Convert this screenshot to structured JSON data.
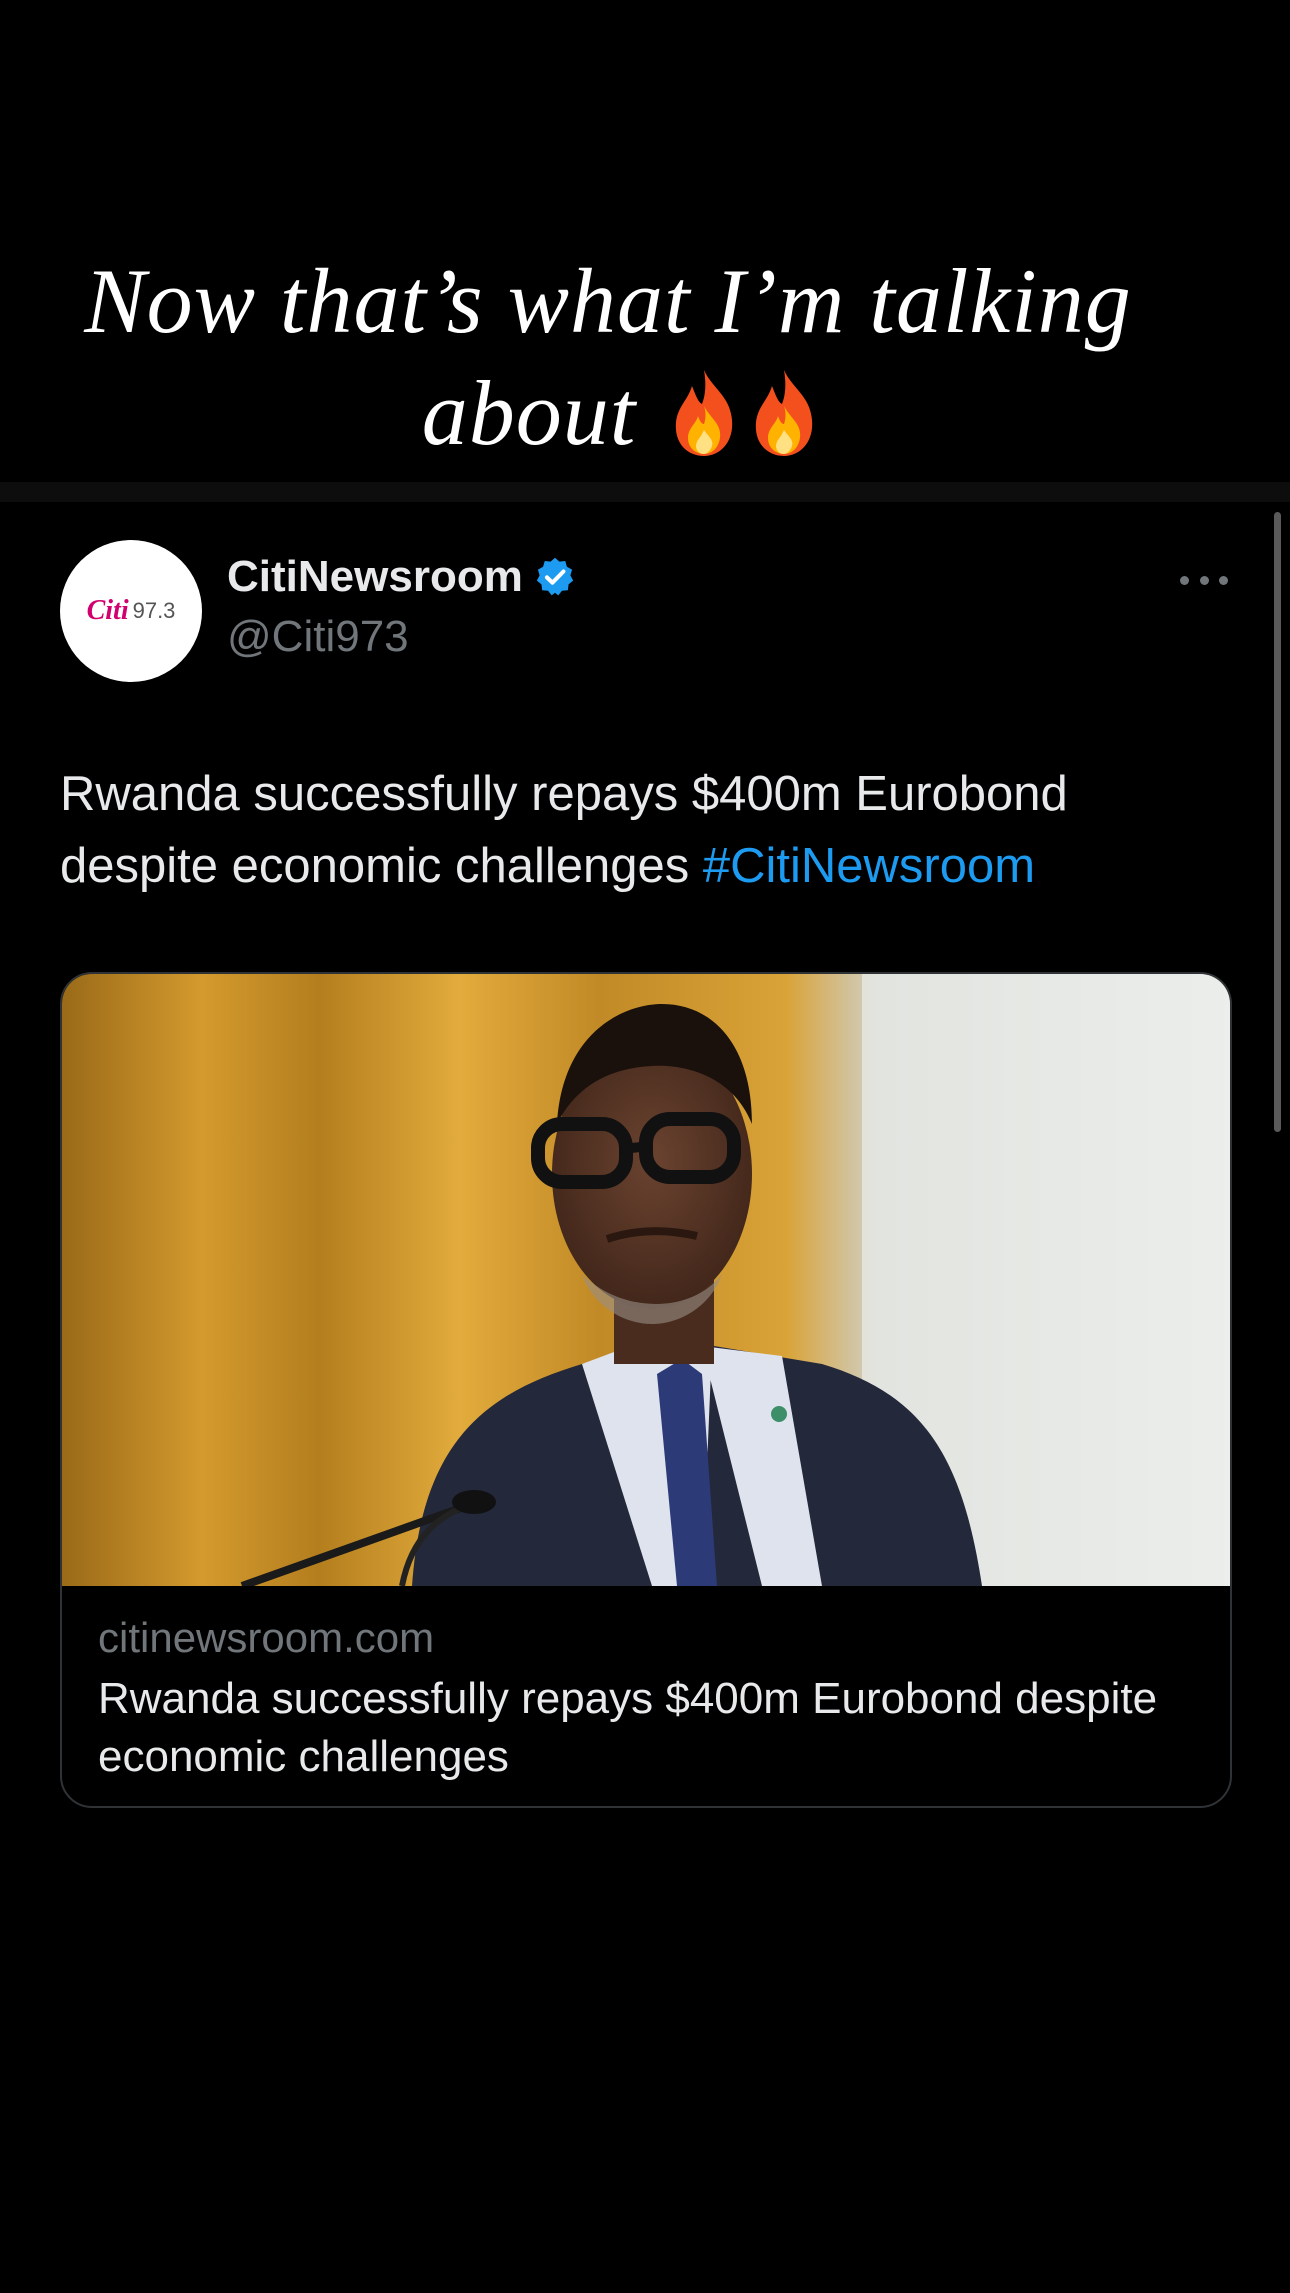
{
  "story_caption": {
    "line1": "Now that’s what I’m talking",
    "line2": "about",
    "emojis": [
      "fire-emoji",
      "fire-emoji"
    ]
  },
  "tweet": {
    "avatar": {
      "brand": "Citi",
      "frequency": "97.3"
    },
    "display_name": "CitiNewsroom",
    "verified": true,
    "handle": "@Citi973",
    "text": "Rwanda successfully repays $400m Eurobond despite economic challenges",
    "hashtag": "#CitiNewsroom",
    "link_card": {
      "image_icon": "news-photo",
      "domain": "citinewsroom.com",
      "title": "Rwanda successfully repays $400m Eurobond despite economic challenges"
    }
  },
  "colors": {
    "background": "#000000",
    "text": "#e7e9ea",
    "secondary_text": "#71767b",
    "link": "#1d9bf0",
    "brand": "#d1006e"
  }
}
